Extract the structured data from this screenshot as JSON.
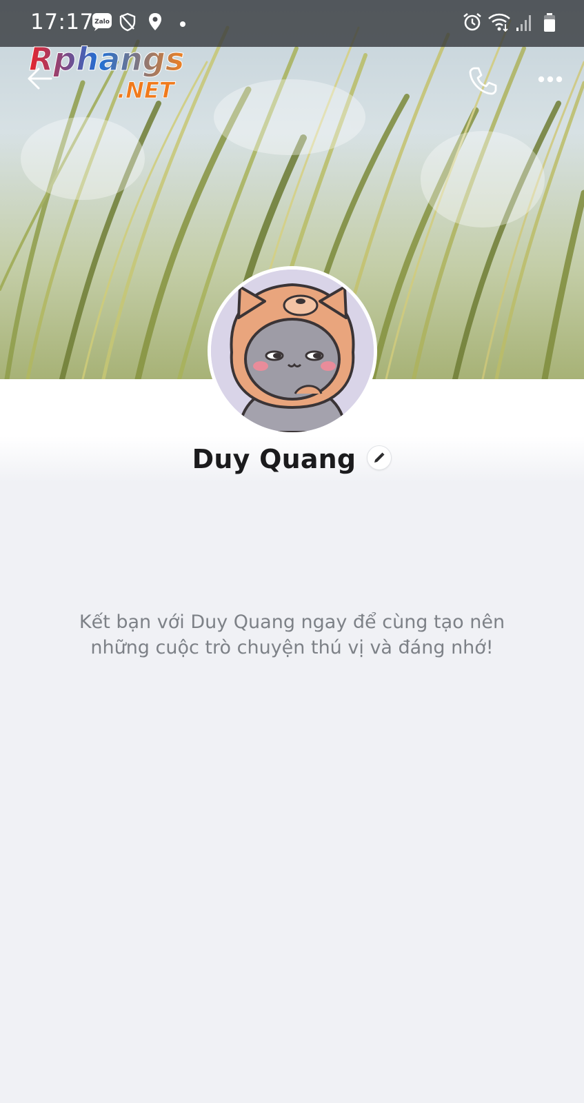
{
  "status_bar": {
    "time": "17:17",
    "icons": [
      "zalo-icon",
      "shield-icon",
      "location-icon",
      "dot-icon",
      "alarm-icon",
      "wifi-icon",
      "signal-icon",
      "battery-icon"
    ]
  },
  "watermark": {
    "line1": "Rphangs",
    "line2": ".NET"
  },
  "header": {
    "back_icon": "arrow-left-icon",
    "call_icon": "phone-icon",
    "more_icon": "more-horizontal-icon"
  },
  "profile": {
    "name": "Duy Quang",
    "edit_icon": "pencil-icon",
    "avatar_desc": "avatar"
  },
  "message": {
    "line1": "Kết bạn với Duy Quang ngay để cùng tạo nên",
    "line2": "những cuộc trò chuyện thú vị và đáng nhớ!"
  },
  "colors": {
    "background": "#f0f1f5",
    "name_text": "#1b1b1d",
    "message_text": "#7d8187",
    "avatar_hood": "#e9a57d"
  }
}
